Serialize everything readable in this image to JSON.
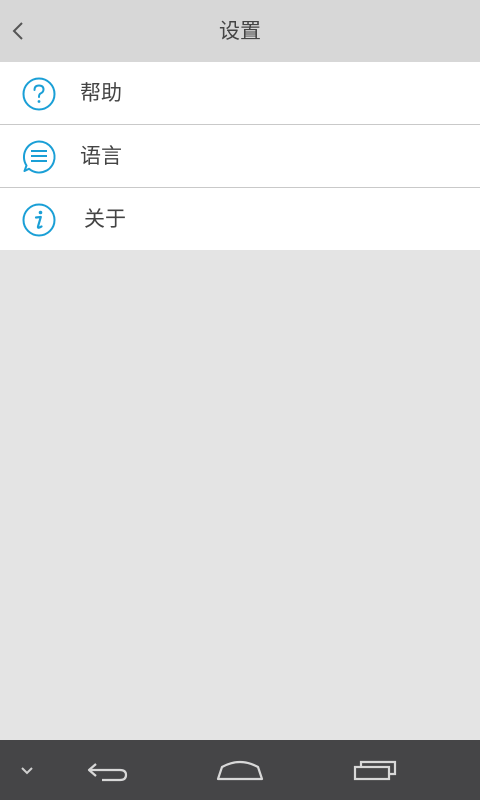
{
  "header": {
    "title": "设置",
    "back_icon": "chevron-left-icon"
  },
  "menu": {
    "items": [
      {
        "label": "帮助",
        "icon": "help-circle-icon"
      },
      {
        "label": "语言",
        "icon": "language-bubble-icon"
      },
      {
        "label": "关于",
        "icon": "info-circle-icon"
      }
    ]
  },
  "navbar": {
    "icons": [
      "chevron-down-icon",
      "back-arrow-icon",
      "home-icon",
      "recent-apps-icon"
    ]
  },
  "colors": {
    "accent": "#1a9fd6",
    "header_bg": "#d7d7d7",
    "page_bg": "#e4e4e4",
    "navbar_bg": "#454547",
    "text": "#444444"
  }
}
